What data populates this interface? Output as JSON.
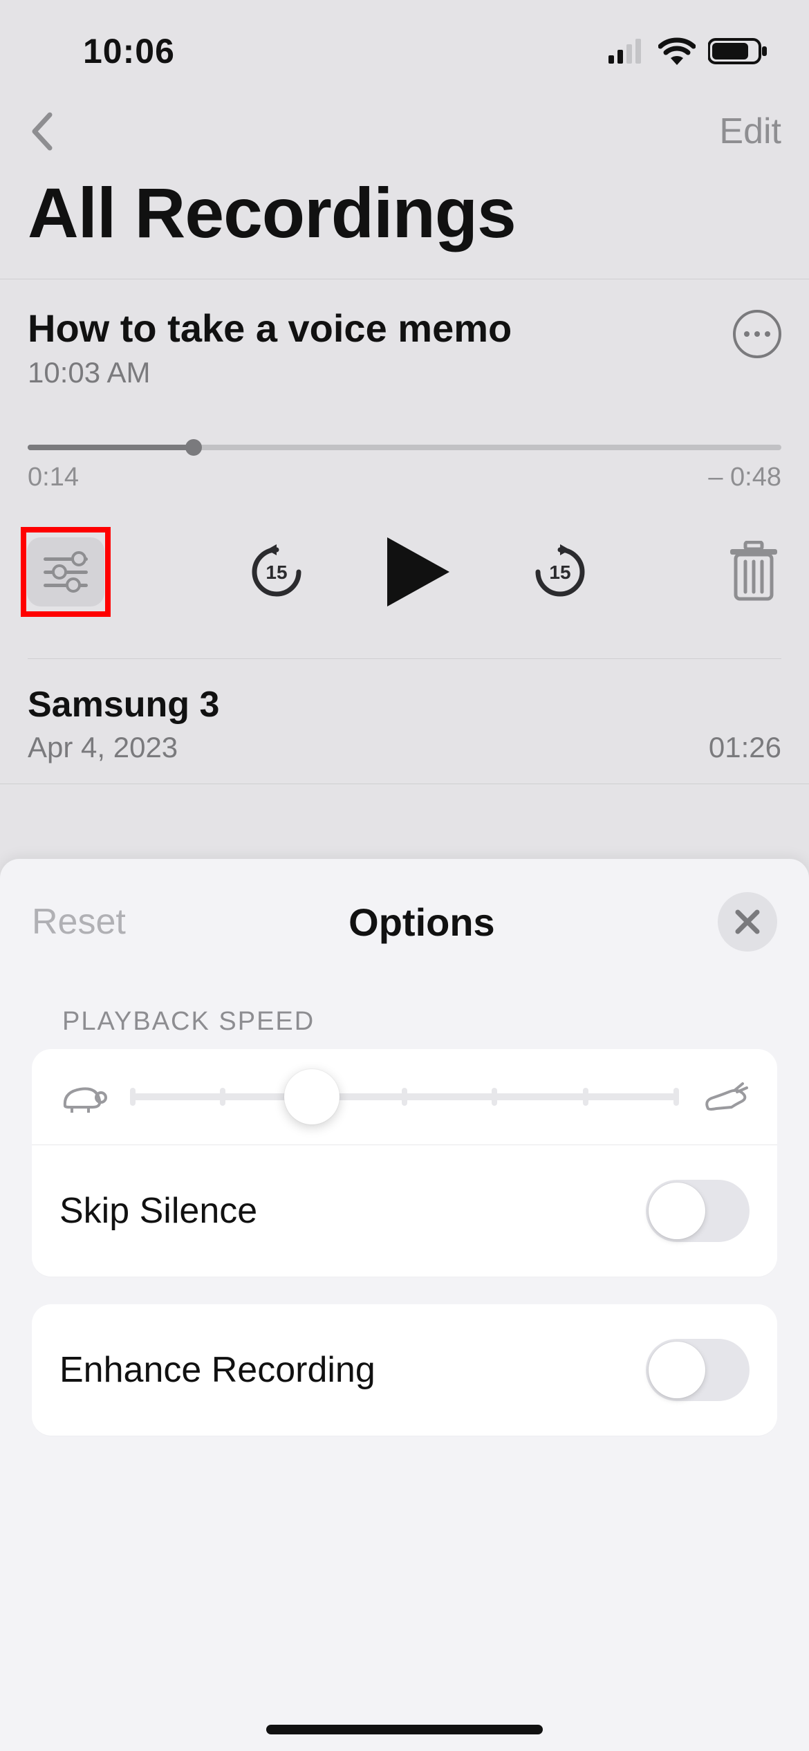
{
  "statusbar": {
    "time": "10:06"
  },
  "nav": {
    "edit": "Edit"
  },
  "page_title": "All Recordings",
  "selected": {
    "title": "How to take a voice memo",
    "subtitle": "10:03 AM",
    "elapsed": "0:14",
    "remaining": "– 0:48",
    "progress_pct": 22
  },
  "controls": {
    "skip_secs": "15"
  },
  "list": [
    {
      "title": "Samsung 3",
      "date": "Apr 4, 2023",
      "duration": "01:26"
    }
  ],
  "sheet": {
    "reset": "Reset",
    "title": "Options",
    "section_speed": "PLAYBACK SPEED",
    "skip_silence": "Skip Silence",
    "enhance_rec": "Enhance Recording"
  }
}
